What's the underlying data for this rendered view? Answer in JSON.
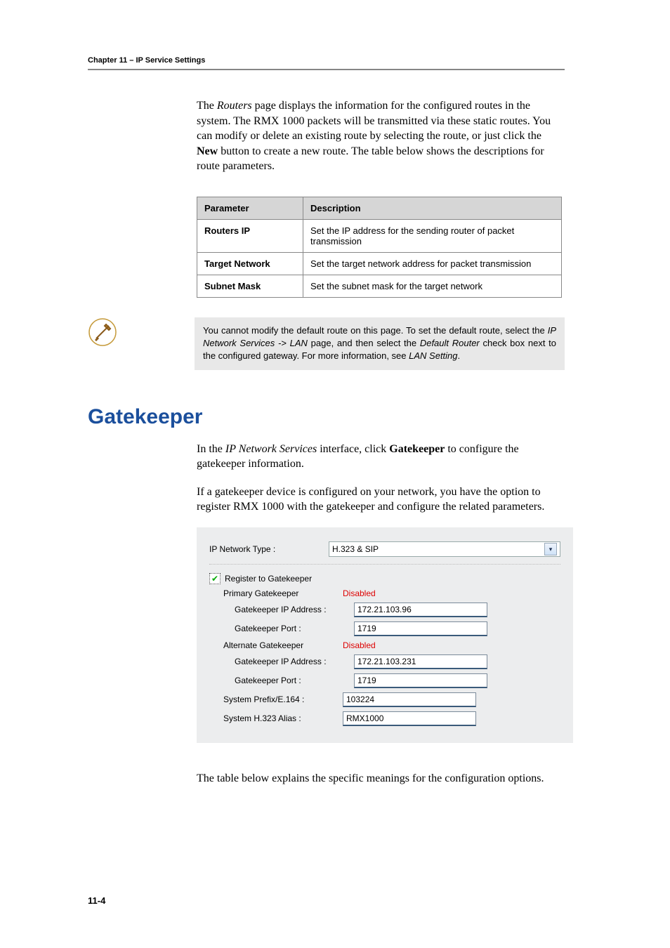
{
  "header": "Chapter 11 – IP Service Settings",
  "intro": {
    "pre": "The ",
    "em": "Routers",
    "post": " page displays the information for the configured routes in the system. The RMX 1000 packets will be transmitted via these static routes. You can modify or delete an existing route by selecting the route, or just click the ",
    "bold": "New",
    "tail": " button to create a new route. The table below shows the descriptions for route parameters."
  },
  "table": {
    "headers": [
      "Parameter",
      "Description"
    ],
    "rows": [
      {
        "param": "Routers IP",
        "desc": "Set the IP address for the sending router of packet transmission"
      },
      {
        "param": "Target Network",
        "desc": "Set the target network address for packet transmission"
      },
      {
        "param": "Subnet Mask",
        "desc": "Set the subnet mask for the target network"
      }
    ]
  },
  "note": {
    "line1a": "You cannot modify the default route on this page. To set the default route, select the ",
    "em1": "IP Network Services -> LAN",
    "line1b": " page, and then select the ",
    "em2": "Default Router",
    "line1c": " check box next to the configured gateway. For more information, see ",
    "em3": "LAN Setting",
    "line1d": "."
  },
  "section_title": "Gatekeeper",
  "gk_intro1": {
    "pre": "In the ",
    "em": "IP Network Services",
    "mid": " interface, click ",
    "bold": "Gatekeeper",
    "post": " to configure the gatekeeper information."
  },
  "gk_intro2": "If a gatekeeper device is configured on your network, you have the option to register RMX 1000 with the gatekeeper and configure the related parameters.",
  "screenshot": {
    "ip_network_type_label": "IP Network Type :",
    "ip_network_type_value": "H.323 & SIP",
    "register_label": "Register to Gatekeeper",
    "register_checked": true,
    "primary_label": "Primary Gatekeeper",
    "primary_status": "Disabled",
    "primary_ip_label": "Gatekeeper IP Address :",
    "primary_ip": "172.21.103.96",
    "primary_port_label": "Gatekeeper Port :",
    "primary_port": "1719",
    "alt_label": "Alternate Gatekeeper",
    "alt_status": "Disabled",
    "alt_ip_label": "Gatekeeper IP Address :",
    "alt_ip": "172.21.103.231",
    "alt_port_label": "Gatekeeper Port :",
    "alt_port": "1719",
    "prefix_label": "System Prefix/E.164 :",
    "prefix": "103224",
    "alias_label": "System H.323 Alias :",
    "alias": "RMX1000"
  },
  "closing": "The table below explains the specific meanings for the configuration options.",
  "page_number": "11-4"
}
